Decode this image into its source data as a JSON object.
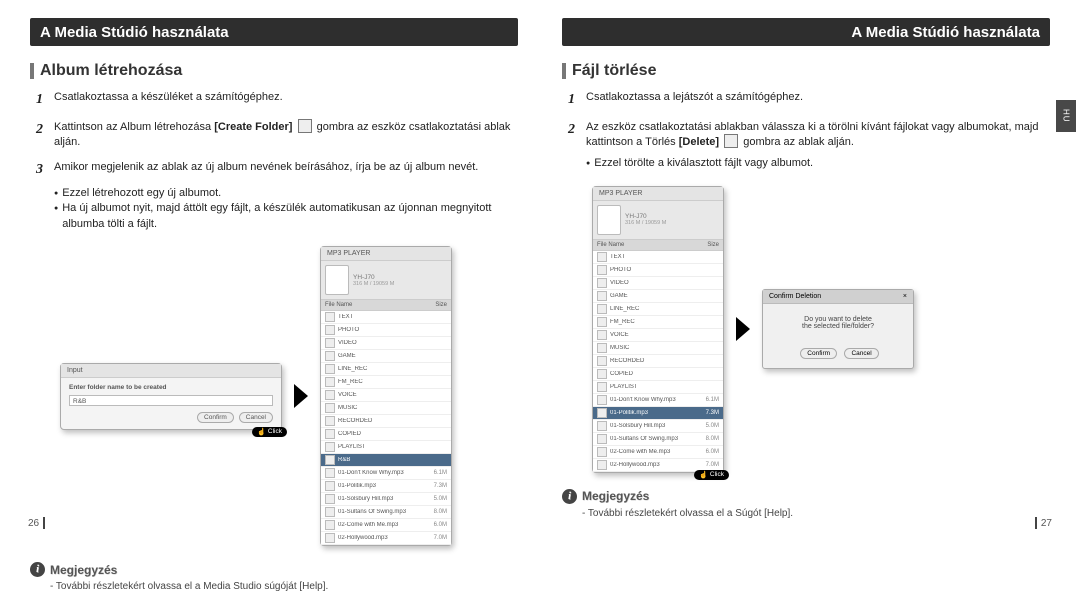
{
  "header_left": "A Media Stúdió használata",
  "header_right": "A Media Stúdió használata",
  "side_tab": "HU",
  "left": {
    "section_title": "Album létrehozása",
    "step1": "Csatlakoztassa a készüléket a számítógéphez.",
    "step2_a": "Kattintson az Album létrehozása ",
    "step2_bold": "[Create Folder]",
    "step2_b": " gombra az eszköz csatlakoztatási ablak alján.",
    "step3": "Amikor megjelenik az ablak az új album nevének beírásához, írja be az új album nevét.",
    "bullets": [
      "Ezzel létrehozott egy új albumot.",
      "Ha új albumot nyit, majd áttölt egy fájlt, a készülék automatikusan az újonnan megnyitott albumba tölti a fájlt."
    ],
    "dialog": {
      "title": "Input",
      "label": "Enter folder name to be created",
      "value": "R&B",
      "confirm": "Confirm",
      "cancel": "Cancel"
    },
    "click": "Click",
    "player": {
      "title": "MP3 PLAYER",
      "name": "YH-J70",
      "sub": "316 M / 19059 M",
      "col_name": "File Name",
      "col_size": "Size",
      "folders": [
        "TEXT",
        "PHOTO",
        "VIDEO",
        "GAME",
        "LINE_REC",
        "FM_REC",
        "VOICE",
        "MUSIC",
        "RECORDED",
        "COPIED",
        "PLAYLIST"
      ],
      "sel_folder": "R&B",
      "files": [
        {
          "n": "01-Don't Know Why.mp3",
          "s": "6.1M"
        },
        {
          "n": "01-Politik.mp3",
          "s": "7.3M"
        },
        {
          "n": "01-Solsbury Hill.mp3",
          "s": "5.0M"
        },
        {
          "n": "01-Sultans Of Swing.mp3",
          "s": "8.0M"
        },
        {
          "n": "02-Come with Me.mp3",
          "s": "6.0M"
        },
        {
          "n": "02-Hollywood.mp3",
          "s": "7.0M"
        }
      ]
    },
    "note_head": "Megjegyzés",
    "note_text": "- További részletekért olvassa el a Media Studio súgóját [Help].",
    "page_num": "26"
  },
  "right": {
    "section_title": "Fájl törlése",
    "step1": "Csatlakoztassa a lejátszót a számítógéphez.",
    "step2_a": "Az eszköz csatlakoztatási ablakban válassza ki a törölni kívánt fájlokat vagy albumokat, majd kattintson a Törlés ",
    "step2_bold": "[Delete]",
    "step2_b": " gombra az ablak alján.",
    "bullet": "Ezzel törölte a kiválasztott fájlt vagy albumot.",
    "player": {
      "title": "MP3 PLAYER",
      "name": "YH-J70",
      "sub": "316 M / 19059 M",
      "col_name": "File Name",
      "col_size": "Size",
      "folders": [
        "TEXT",
        "PHOTO",
        "VIDEO",
        "GAME",
        "LINE_REC",
        "FM_REC",
        "VOICE",
        "MUSIC",
        "RECORDED",
        "COPIED",
        "PLAYLIST"
      ],
      "files": [
        {
          "n": "01-Don't Know Why.mp3",
          "s": "6.1M"
        },
        {
          "n": "01-Politik.mp3",
          "s": "7.3M",
          "sel": true
        },
        {
          "n": "01-Solsbury Hill.mp3",
          "s": "5.0M"
        },
        {
          "n": "01-Sultans Of Swing.mp3",
          "s": "8.0M"
        },
        {
          "n": "02-Come with Me.mp3",
          "s": "6.0M"
        },
        {
          "n": "02-Hollywood.mp3",
          "s": "7.0M"
        }
      ]
    },
    "dialog": {
      "title": "Confirm Deletion",
      "line1": "Do you want to delete",
      "line2": "the selected file/folder?",
      "confirm": "Confirm",
      "cancel": "Cancel"
    },
    "click": "Click",
    "note_head": "Megjegyzés",
    "note_text": "- További részletekért olvassa el a Súgót [Help].",
    "page_num": "27"
  }
}
